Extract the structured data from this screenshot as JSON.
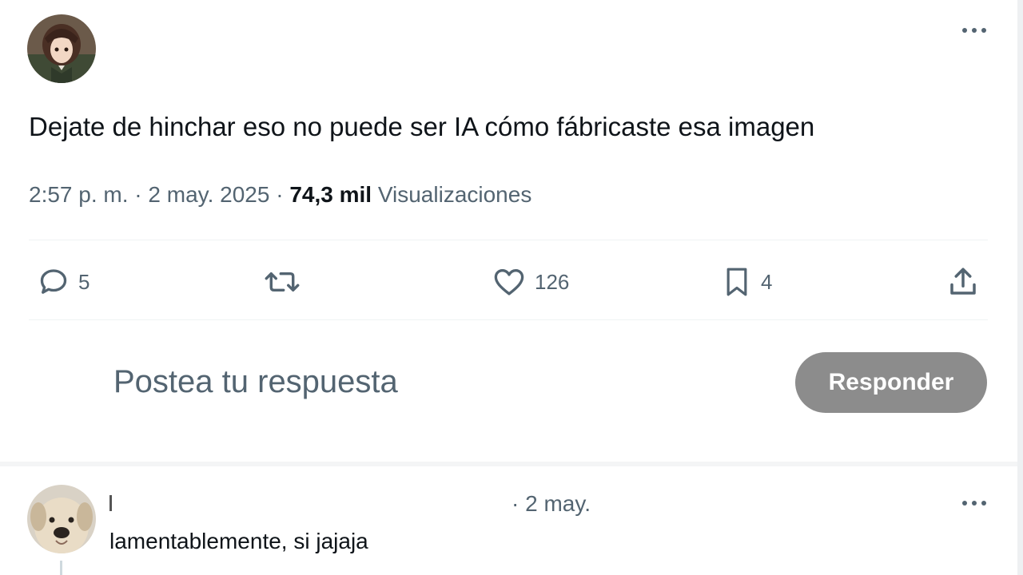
{
  "tweet": {
    "text": "Dejate de hinchar eso no puede ser IA cómo fábricaste esa imagen",
    "time": "2:57 p. m.",
    "sep1": "·",
    "date": "2 may. 2025",
    "sep2": "·",
    "views_count": "74,3 mil",
    "views_label": "Visualizaciones",
    "actions": {
      "replies": "5",
      "retweets": "",
      "likes": "126",
      "bookmarks": "4"
    },
    "icons": {
      "more": "more-horizontal-icon",
      "reply": "reply-bubble-icon",
      "retweet": "retweet-icon",
      "like": "heart-icon",
      "bookmark": "bookmark-icon",
      "share": "share-upload-icon"
    }
  },
  "composer": {
    "placeholder": "Postea tu respuesta",
    "button_label": "Responder",
    "button_color": "#8c8c8c"
  },
  "reply": {
    "date": "· 2 may.",
    "text": "lamentablemente, si jajaja"
  },
  "colors": {
    "text_primary": "#0f1419",
    "text_secondary": "#536471",
    "divider": "#eff3f4"
  }
}
